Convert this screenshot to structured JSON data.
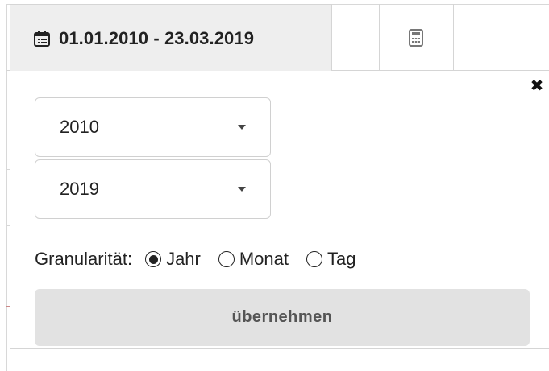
{
  "date_range": {
    "label": "01.01.2010 - 23.03.2019",
    "icon": "calendar-icon"
  },
  "toolbar": {
    "calculator_icon": "calculator-icon"
  },
  "popover": {
    "close_icon": "close-icon",
    "close_glyph": "✖",
    "from_year": {
      "value": "2010"
    },
    "to_year": {
      "value": "2019"
    },
    "granularity": {
      "label": "Granularität:",
      "options": [
        {
          "label": "Jahr",
          "selected": true
        },
        {
          "label": "Monat",
          "selected": false
        },
        {
          "label": "Tag",
          "selected": false
        }
      ]
    },
    "apply_label": "übernehmen"
  },
  "colors": {
    "tab_background": "#eeeeee",
    "button_background": "#e2e2e2",
    "border": "#d5d5d5"
  }
}
